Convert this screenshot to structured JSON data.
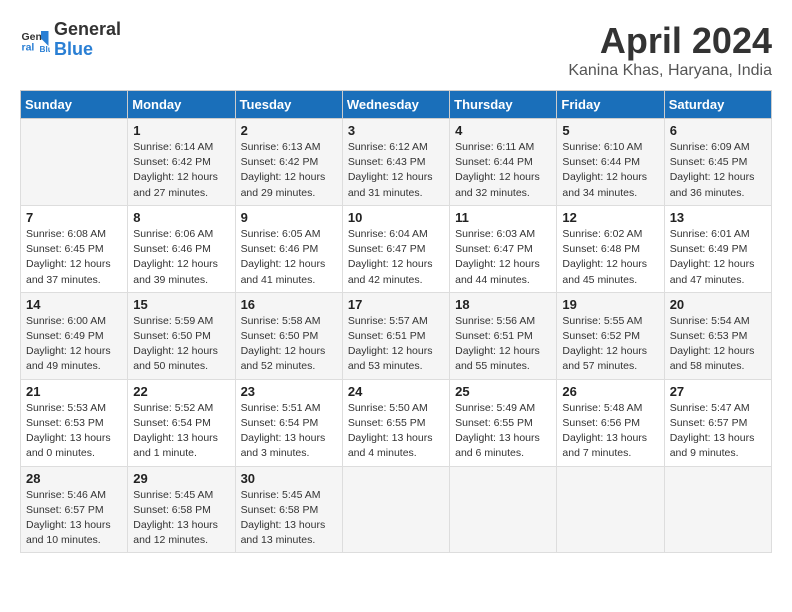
{
  "header": {
    "logo_line1": "General",
    "logo_line2": "Blue",
    "month": "April 2024",
    "location": "Kanina Khas, Haryana, India"
  },
  "days_of_week": [
    "Sunday",
    "Monday",
    "Tuesday",
    "Wednesday",
    "Thursday",
    "Friday",
    "Saturday"
  ],
  "weeks": [
    [
      {
        "day": "",
        "sunrise": "",
        "sunset": "",
        "daylight": ""
      },
      {
        "day": "1",
        "sunrise": "6:14 AM",
        "sunset": "6:42 PM",
        "daylight": "12 hours and 27 minutes."
      },
      {
        "day": "2",
        "sunrise": "6:13 AM",
        "sunset": "6:42 PM",
        "daylight": "12 hours and 29 minutes."
      },
      {
        "day": "3",
        "sunrise": "6:12 AM",
        "sunset": "6:43 PM",
        "daylight": "12 hours and 31 minutes."
      },
      {
        "day": "4",
        "sunrise": "6:11 AM",
        "sunset": "6:44 PM",
        "daylight": "12 hours and 32 minutes."
      },
      {
        "day": "5",
        "sunrise": "6:10 AM",
        "sunset": "6:44 PM",
        "daylight": "12 hours and 34 minutes."
      },
      {
        "day": "6",
        "sunrise": "6:09 AM",
        "sunset": "6:45 PM",
        "daylight": "12 hours and 36 minutes."
      }
    ],
    [
      {
        "day": "7",
        "sunrise": "6:08 AM",
        "sunset": "6:45 PM",
        "daylight": "12 hours and 37 minutes."
      },
      {
        "day": "8",
        "sunrise": "6:06 AM",
        "sunset": "6:46 PM",
        "daylight": "12 hours and 39 minutes."
      },
      {
        "day": "9",
        "sunrise": "6:05 AM",
        "sunset": "6:46 PM",
        "daylight": "12 hours and 41 minutes."
      },
      {
        "day": "10",
        "sunrise": "6:04 AM",
        "sunset": "6:47 PM",
        "daylight": "12 hours and 42 minutes."
      },
      {
        "day": "11",
        "sunrise": "6:03 AM",
        "sunset": "6:47 PM",
        "daylight": "12 hours and 44 minutes."
      },
      {
        "day": "12",
        "sunrise": "6:02 AM",
        "sunset": "6:48 PM",
        "daylight": "12 hours and 45 minutes."
      },
      {
        "day": "13",
        "sunrise": "6:01 AM",
        "sunset": "6:49 PM",
        "daylight": "12 hours and 47 minutes."
      }
    ],
    [
      {
        "day": "14",
        "sunrise": "6:00 AM",
        "sunset": "6:49 PM",
        "daylight": "12 hours and 49 minutes."
      },
      {
        "day": "15",
        "sunrise": "5:59 AM",
        "sunset": "6:50 PM",
        "daylight": "12 hours and 50 minutes."
      },
      {
        "day": "16",
        "sunrise": "5:58 AM",
        "sunset": "6:50 PM",
        "daylight": "12 hours and 52 minutes."
      },
      {
        "day": "17",
        "sunrise": "5:57 AM",
        "sunset": "6:51 PM",
        "daylight": "12 hours and 53 minutes."
      },
      {
        "day": "18",
        "sunrise": "5:56 AM",
        "sunset": "6:51 PM",
        "daylight": "12 hours and 55 minutes."
      },
      {
        "day": "19",
        "sunrise": "5:55 AM",
        "sunset": "6:52 PM",
        "daylight": "12 hours and 57 minutes."
      },
      {
        "day": "20",
        "sunrise": "5:54 AM",
        "sunset": "6:53 PM",
        "daylight": "12 hours and 58 minutes."
      }
    ],
    [
      {
        "day": "21",
        "sunrise": "5:53 AM",
        "sunset": "6:53 PM",
        "daylight": "13 hours and 0 minutes."
      },
      {
        "day": "22",
        "sunrise": "5:52 AM",
        "sunset": "6:54 PM",
        "daylight": "13 hours and 1 minute."
      },
      {
        "day": "23",
        "sunrise": "5:51 AM",
        "sunset": "6:54 PM",
        "daylight": "13 hours and 3 minutes."
      },
      {
        "day": "24",
        "sunrise": "5:50 AM",
        "sunset": "6:55 PM",
        "daylight": "13 hours and 4 minutes."
      },
      {
        "day": "25",
        "sunrise": "5:49 AM",
        "sunset": "6:55 PM",
        "daylight": "13 hours and 6 minutes."
      },
      {
        "day": "26",
        "sunrise": "5:48 AM",
        "sunset": "6:56 PM",
        "daylight": "13 hours and 7 minutes."
      },
      {
        "day": "27",
        "sunrise": "5:47 AM",
        "sunset": "6:57 PM",
        "daylight": "13 hours and 9 minutes."
      }
    ],
    [
      {
        "day": "28",
        "sunrise": "5:46 AM",
        "sunset": "6:57 PM",
        "daylight": "13 hours and 10 minutes."
      },
      {
        "day": "29",
        "sunrise": "5:45 AM",
        "sunset": "6:58 PM",
        "daylight": "13 hours and 12 minutes."
      },
      {
        "day": "30",
        "sunrise": "5:45 AM",
        "sunset": "6:58 PM",
        "daylight": "13 hours and 13 minutes."
      },
      {
        "day": "",
        "sunrise": "",
        "sunset": "",
        "daylight": ""
      },
      {
        "day": "",
        "sunrise": "",
        "sunset": "",
        "daylight": ""
      },
      {
        "day": "",
        "sunrise": "",
        "sunset": "",
        "daylight": ""
      },
      {
        "day": "",
        "sunrise": "",
        "sunset": "",
        "daylight": ""
      }
    ]
  ],
  "labels": {
    "sunrise_prefix": "Sunrise: ",
    "sunset_prefix": "Sunset: ",
    "daylight_prefix": "Daylight: "
  }
}
